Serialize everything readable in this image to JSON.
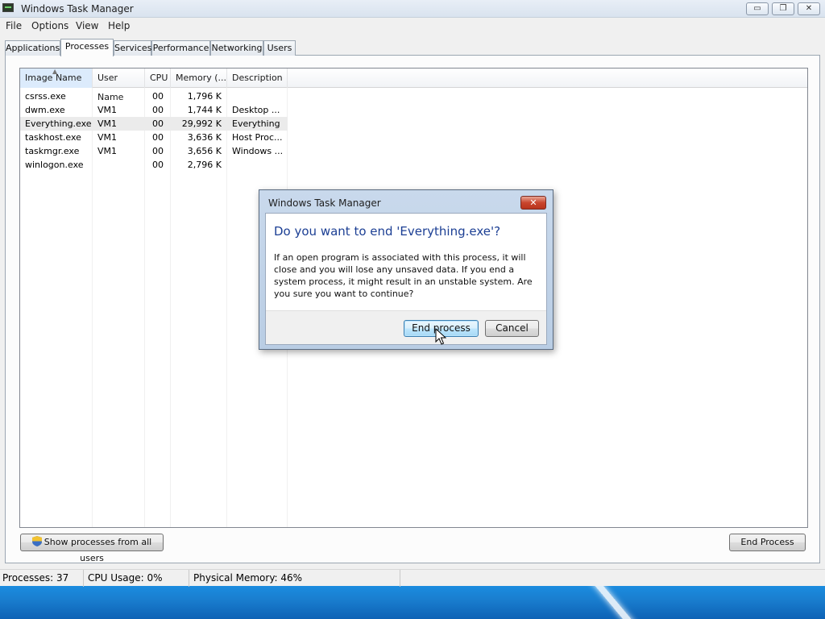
{
  "window": {
    "title": "Windows Task Manager",
    "controls": {
      "minimize": "▭",
      "maximize": "❐",
      "close": "✕"
    }
  },
  "menu": [
    "File",
    "Options",
    "View",
    "Help"
  ],
  "tabs": [
    {
      "label": "Applications",
      "active": false
    },
    {
      "label": "Processes",
      "active": true
    },
    {
      "label": "Services",
      "active": false
    },
    {
      "label": "Performance",
      "active": false
    },
    {
      "label": "Networking",
      "active": false
    },
    {
      "label": "Users",
      "active": false
    }
  ],
  "table": {
    "columns": [
      "Image Name",
      "User Name",
      "CPU",
      "Memory (...",
      "Description"
    ],
    "sorted_column": "Image Name",
    "rows": [
      {
        "image": "csrss.exe",
        "user": "",
        "cpu": "00",
        "memory": "1,796 K",
        "description": "",
        "selected": false
      },
      {
        "image": "dwm.exe",
        "user": "VM1",
        "cpu": "00",
        "memory": "1,744 K",
        "description": "Desktop ...",
        "selected": false
      },
      {
        "image": "Everything.exe",
        "user": "VM1",
        "cpu": "00",
        "memory": "29,992 K",
        "description": "Everything",
        "selected": true
      },
      {
        "image": "taskhost.exe",
        "user": "VM1",
        "cpu": "00",
        "memory": "3,636 K",
        "description": "Host Proc...",
        "selected": false
      },
      {
        "image": "taskmgr.exe",
        "user": "VM1",
        "cpu": "00",
        "memory": "3,656 K",
        "description": "Windows ...",
        "selected": false
      },
      {
        "image": "winlogon.exe",
        "user": "",
        "cpu": "00",
        "memory": "2,796 K",
        "description": "",
        "selected": false
      }
    ]
  },
  "buttons": {
    "show_all_users": "Show processes from all users",
    "end_process": "End Process"
  },
  "statusbar": {
    "processes": "Processes: 37",
    "cpu": "CPU Usage: 0%",
    "memory": "Physical Memory: 46%"
  },
  "dialog": {
    "title": "Windows Task Manager",
    "close": "✕",
    "heading": "Do you want to end 'Everything.exe'?",
    "message": "If an open program is associated with this process, it will close and you will lose any unsaved data. If you end a system process, it might result in an unstable system. Are you sure you want to continue?",
    "confirm": "End process",
    "cancel": "Cancel"
  },
  "colors": {
    "dialog_heading": "#1c3f94",
    "selected_row": "#ebebeb",
    "desktop": "#1a7fd0"
  },
  "icons": {
    "app": "task-manager-icon",
    "shield": "uac-shield-icon",
    "cursor": "mouse-pointer-icon"
  }
}
